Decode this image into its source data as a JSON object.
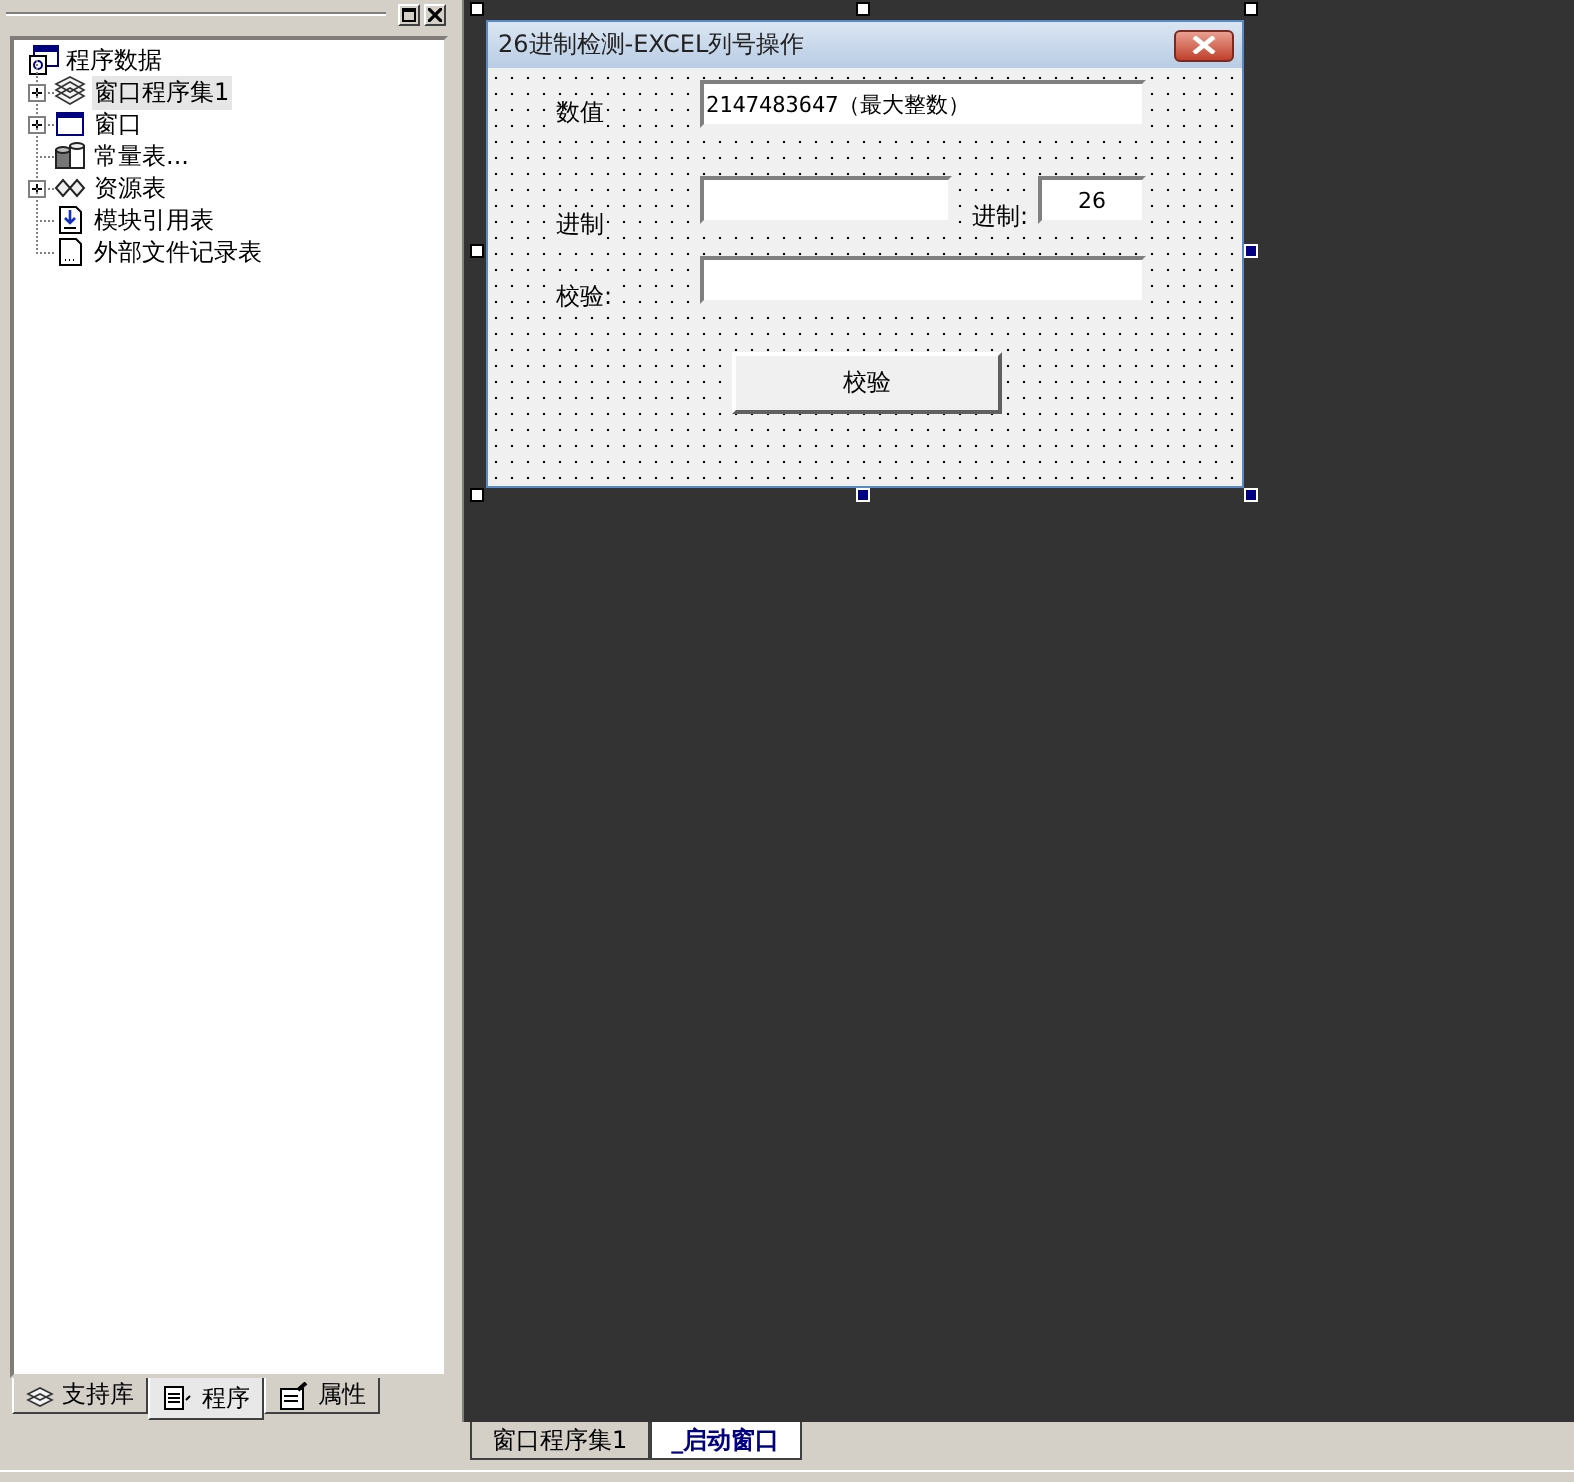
{
  "tree": {
    "label": "程序数据",
    "children": [
      {
        "label": "窗口程序集1",
        "kind": "group",
        "expanded": false,
        "selected": true
      },
      {
        "label": "窗口",
        "kind": "group",
        "expanded": false,
        "selected": false
      },
      {
        "label": "常量表...",
        "kind": "leaf",
        "selected": false
      },
      {
        "label": "资源表",
        "kind": "group",
        "expanded": false,
        "selected": false
      },
      {
        "label": "模块引用表",
        "kind": "leaf",
        "selected": false
      },
      {
        "label": "外部文件记录表",
        "kind": "leaf",
        "selected": false
      }
    ]
  },
  "panel_tabs": [
    {
      "label": "支持库",
      "selected": false
    },
    {
      "label": "程序",
      "selected": true
    },
    {
      "label": "属性",
      "selected": false
    }
  ],
  "form": {
    "title": "26进制检测-EXCEL列号操作",
    "value_label": "数值",
    "value": "2147483647（最大整数）",
    "base_label": "进制",
    "radix_label": "进制:",
    "radix": "26",
    "check_label": "校验:",
    "button": "校验"
  },
  "doc_tabs": [
    {
      "label": "窗口程序集1",
      "selected": false
    },
    {
      "label": "_启动窗口",
      "selected": true
    }
  ]
}
